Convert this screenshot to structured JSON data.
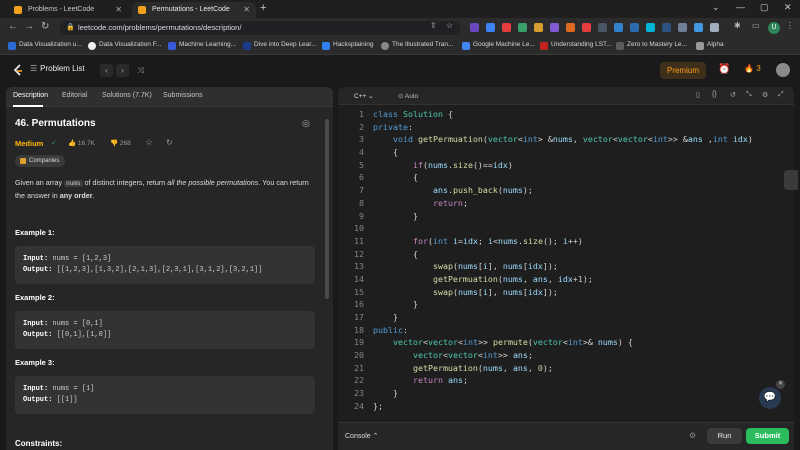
{
  "browser": {
    "tabs": [
      {
        "title": "Problems - LeetCode"
      },
      {
        "title": "Permutations - LeetCode"
      }
    ],
    "url": "leetcode.com/problems/permutations/description/",
    "bookmarks": [
      "Data Visualization u...",
      "Data Visualization F...",
      "Machine Learning...",
      "Dive into Deep Lear...",
      "Hacksplaining",
      "The Illustrated Tran...",
      "Google Machine Le...",
      "Understanding LST...",
      "Zero to Mastery Le...",
      "Alpha"
    ],
    "bookmark_colors": [
      "#2b6cd4",
      "#222",
      "#3a5bd9",
      "#1e3a8a",
      "#2f80ed",
      "#666",
      "#4285f4",
      "#c5221f",
      "#4a4a4a",
      "#777"
    ],
    "profile_initial": "U"
  },
  "header": {
    "problem_list": "Problem List",
    "premium": "Premium",
    "streak": "3"
  },
  "left": {
    "tabs": [
      "Description",
      "Editorial",
      "Solutions (7.7K)",
      "Submissions"
    ],
    "title": "46. Permutations",
    "difficulty": "Medium",
    "likes": "16.7K",
    "dislikes": "268",
    "companies": "Companies",
    "description": {
      "p1": "Given an array ",
      "code": "nums",
      "p2": " of distinct integers, return ",
      "em": "all the possible permutations",
      "p3": ". You can return the answer in ",
      "strong": "any order",
      "p4": "."
    },
    "examples": [
      {
        "label": "Example 1:",
        "input_key": "Input:",
        "input": " nums = [1,2,3]",
        "output_key": "Output:",
        "output": " [[1,2,3],[1,3,2],[2,1,3],[2,3,1],[3,1,2],[3,2,1]]"
      },
      {
        "label": "Example 2:",
        "input_key": "Input:",
        "input": " nums = [0,1]",
        "output_key": "Output:",
        "output": " [[0,1],[1,0]]"
      },
      {
        "label": "Example 3:",
        "input_key": "Input:",
        "input": " nums = [1]",
        "output_key": "Output:",
        "output": " [[1]]"
      }
    ],
    "constraints": "Constraints:"
  },
  "editor": {
    "language": "C++",
    "mode": "Auto",
    "lines": [
      "class Solution {",
      "private:",
      "    void getPermuation(vector<int> &nums, vector<vector<int>> &ans ,int idx)",
      "    {",
      "        if(nums.size()==idx)",
      "        {",
      "            ans.push_back(nums);",
      "            return;",
      "        }",
      "",
      "        for(int i=idx; i<nums.size(); i++)",
      "        {",
      "            swap(nums[i], nums[idx]);",
      "            getPermuation(nums, ans, idx+1);",
      "            swap(nums[i], nums[idx]);",
      "        }",
      "    }",
      "public:",
      "    vector<vector<int>> permute(vector<int>& nums) {",
      "        vector<vector<int>> ans;",
      "        getPermuation(nums, ans, 0);",
      "        return ans;",
      "    }",
      "};"
    ]
  },
  "footer": {
    "console": "Console",
    "run": "Run",
    "submit": "Submit"
  }
}
